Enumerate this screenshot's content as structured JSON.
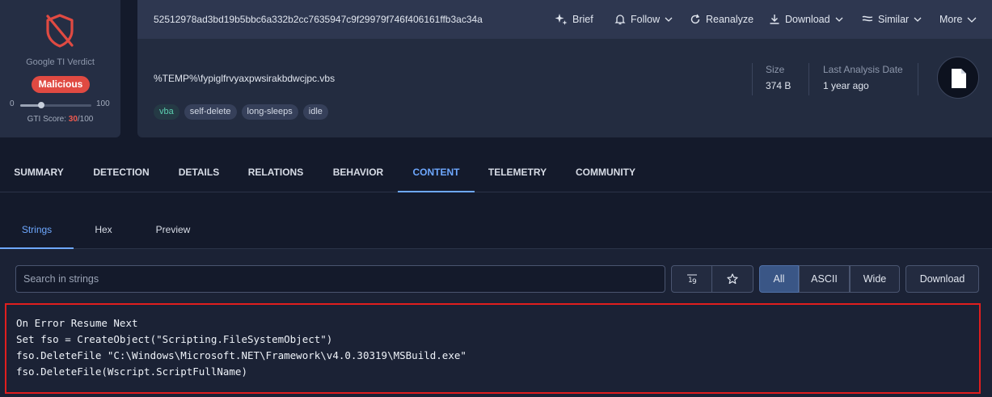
{
  "verdict": {
    "label": "Google TI Verdict",
    "badge": "Malicious",
    "scale_min": "0",
    "scale_max": "100",
    "score_prefix": "GTI Score: ",
    "score_value": "30",
    "score_suffix": "/100",
    "score_fraction": 0.3,
    "icon": "shield-slash-icon",
    "badge_color": "#e04a42"
  },
  "header": {
    "hash": "52512978ad3bd19b5bbc6a332b2cc7635947c9f29979f746f406161ffb3ac34a",
    "actions": [
      {
        "label": "Brief",
        "icon": "sparkle-icon"
      },
      {
        "label": "Follow",
        "icon": "bell-icon"
      },
      {
        "label": "Reanalyze",
        "icon": "refresh-icon"
      },
      {
        "label": "Download",
        "icon": "download-icon"
      },
      {
        "label": "Similar",
        "icon": "similar-icon"
      },
      {
        "label": "More",
        "icon": "chevron-down-icon"
      }
    ],
    "filename": "%TEMP%\\fypiglfrvyaxpwsirakbdwcjpc.vbs",
    "tags": [
      "vba",
      "self-delete",
      "long-sleeps",
      "idle"
    ],
    "size_label": "Size",
    "size_value": "374 B",
    "date_label": "Last Analysis Date",
    "date_value": "1 year ago",
    "file_icon": "file-icon"
  },
  "tabs": [
    "SUMMARY",
    "DETECTION",
    "DETAILS",
    "RELATIONS",
    "BEHAVIOR",
    "CONTENT",
    "TELEMETRY",
    "COMMUNITY"
  ],
  "active_tab": "CONTENT",
  "subtabs": [
    "Strings",
    "Hex",
    "Preview"
  ],
  "active_subtab": "Strings",
  "toolbar": {
    "search_placeholder": "Search in strings",
    "sort_icon": "sort-numeric-icon",
    "star_icon": "star-icon",
    "filters": [
      "All",
      "ASCII",
      "Wide"
    ],
    "active_filter": "All",
    "download_label": "Download"
  },
  "strings": [
    "On Error Resume Next",
    "Set fso = CreateObject(\"Scripting.FileSystemObject\")",
    "fso.DeleteFile \"C:\\Windows\\Microsoft.NET\\Framework\\v4.0.30319\\MSBuild.exe\"",
    "fso.DeleteFile(Wscript.ScriptFullName)"
  ],
  "colors": {
    "accent": "#6ea8ff",
    "highlight_border": "#e01e1e",
    "score_red": "#ef5a4f"
  }
}
